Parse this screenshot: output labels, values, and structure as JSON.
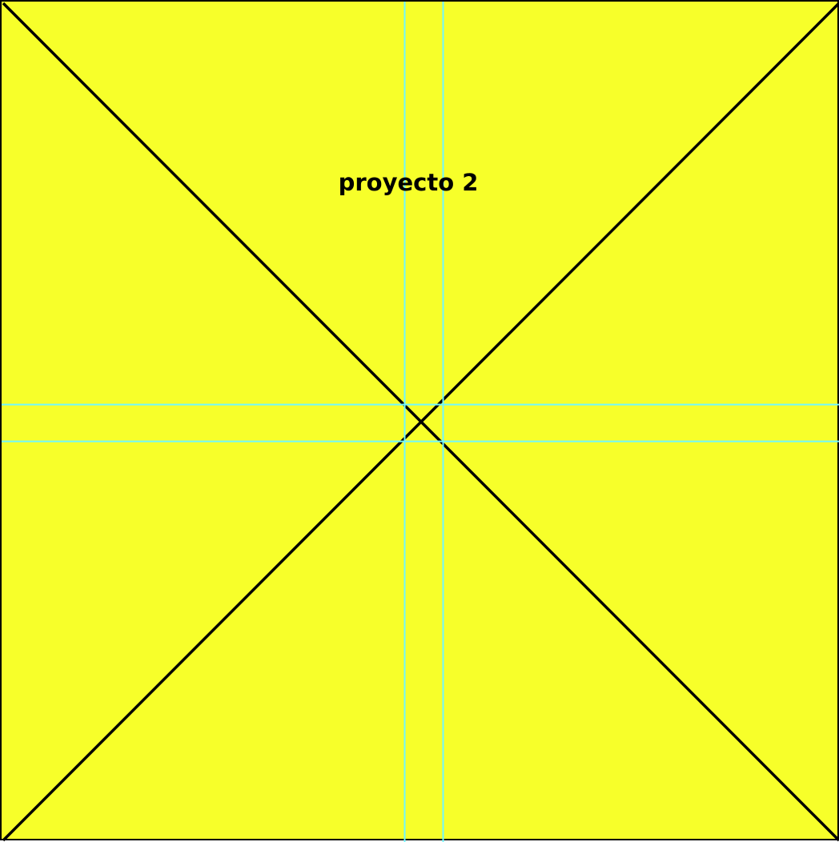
{
  "project": {
    "title": "proyecto 2"
  },
  "colors": {
    "background": "#f7ff2a",
    "lines": "#000000",
    "guides": "#6ff7ff"
  },
  "icons": {
    "placeholder": "placeholder-cross-icon"
  }
}
